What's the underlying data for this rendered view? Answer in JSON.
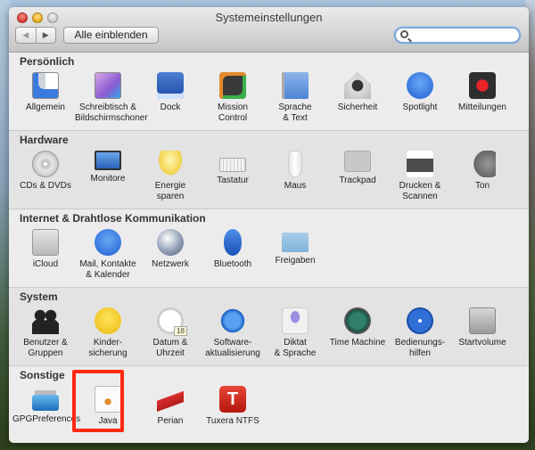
{
  "window": {
    "title": "Systemeinstellungen",
    "show_all_label": "Alle einblenden",
    "back_icon": "back-arrow-icon",
    "forward_icon": "forward-arrow-icon",
    "search": {
      "value": "",
      "placeholder": "",
      "icon": "search-icon"
    }
  },
  "sections": [
    {
      "title": "Persönlich",
      "items": [
        {
          "label": "Allgemein",
          "icon": "general-icon"
        },
        {
          "label": "Schreibtisch &\nBildschirmschoner",
          "icon": "desktop-icon"
        },
        {
          "label": "Dock",
          "icon": "dock-icon"
        },
        {
          "label": "Mission\nControl",
          "icon": "mission-control-icon"
        },
        {
          "label": "Sprache\n& Text",
          "icon": "language-flag-icon"
        },
        {
          "label": "Sicherheit",
          "icon": "security-house-icon"
        },
        {
          "label": "Spotlight",
          "icon": "spotlight-icon"
        },
        {
          "label": "Mitteilungen",
          "icon": "notifications-icon"
        }
      ]
    },
    {
      "title": "Hardware",
      "items": [
        {
          "label": "CDs & DVDs",
          "icon": "cd-icon"
        },
        {
          "label": "Monitore",
          "icon": "monitor-icon"
        },
        {
          "label": "Energie\nsparen",
          "icon": "lightbulb-icon"
        },
        {
          "label": "Tastatur",
          "icon": "keyboard-icon"
        },
        {
          "label": "Maus",
          "icon": "mouse-icon"
        },
        {
          "label": "Trackpad",
          "icon": "trackpad-icon"
        },
        {
          "label": "Drucken &\nScannen",
          "icon": "printer-icon"
        },
        {
          "label": "Ton",
          "icon": "speaker-icon"
        }
      ]
    },
    {
      "title": "Internet & Drahtlose Kommunikation",
      "items": [
        {
          "label": "iCloud",
          "icon": "icloud-icon"
        },
        {
          "label": "Mail, Kontakte\n& Kalender",
          "icon": "mail-at-icon"
        },
        {
          "label": "Netzwerk",
          "icon": "network-globe-icon"
        },
        {
          "label": "Bluetooth",
          "icon": "bluetooth-icon"
        },
        {
          "label": "Freigaben",
          "icon": "sharing-folder-icon"
        }
      ]
    },
    {
      "title": "System",
      "items": [
        {
          "label": "Benutzer &\nGruppen",
          "icon": "users-icon"
        },
        {
          "label": "Kinder-\nsicherung",
          "icon": "parental-controls-icon"
        },
        {
          "label": "Datum &\nUhrzeit",
          "icon": "clock-icon",
          "badge": "18"
        },
        {
          "label": "Software-\naktualisierung",
          "icon": "software-update-icon"
        },
        {
          "label": "Diktat\n& Sprache",
          "icon": "microphone-icon"
        },
        {
          "label": "Time Machine",
          "icon": "time-machine-icon"
        },
        {
          "label": "Bedienungs-\nhilfen",
          "icon": "accessibility-icon"
        },
        {
          "label": "Startvolume",
          "icon": "startup-disk-icon"
        }
      ]
    },
    {
      "title": "Sonstige",
      "items": [
        {
          "label": "GPGPreferences",
          "icon": "padlock-icon"
        },
        {
          "label": "Java",
          "icon": "java-icon"
        },
        {
          "label": "Perian",
          "icon": "swiss-knife-icon"
        },
        {
          "label": "Tuxera NTFS",
          "icon": "tuxera-t-icon",
          "glyph": "T"
        }
      ]
    }
  ],
  "highlight": {
    "target": "Java",
    "color": "#ff2a12"
  }
}
